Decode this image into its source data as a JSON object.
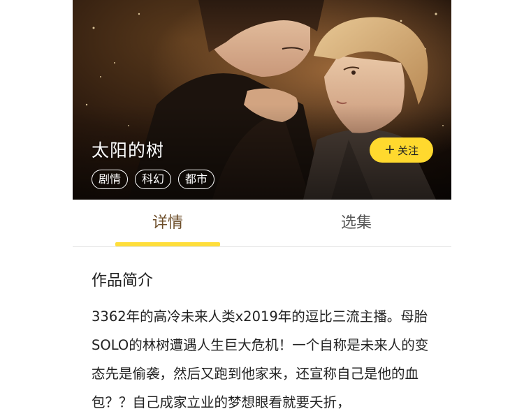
{
  "comic": {
    "title": "太阳的树",
    "tags": [
      "剧情",
      "科幻",
      "都市"
    ],
    "follow_label": "关注",
    "follow_icon": "plus-icon"
  },
  "tabs": {
    "details": "详情",
    "episodes": "选集",
    "active": "details"
  },
  "intro": {
    "heading": "作品简介",
    "text": "3362年的高冷未来人类x2019年的逗比三流主播。母胎SOLO的林树遭遇人生巨大危机！一个自称是未来人的变态先是偷袭，然后又跑到他家来，还宣称自己是他的血包？？自己成家立业的梦想眼看就要夭折，"
  },
  "colors": {
    "accent_yellow": "#ffd92e",
    "active_tab_text": "#6d4e2a",
    "inactive_tab_text": "#555555"
  }
}
